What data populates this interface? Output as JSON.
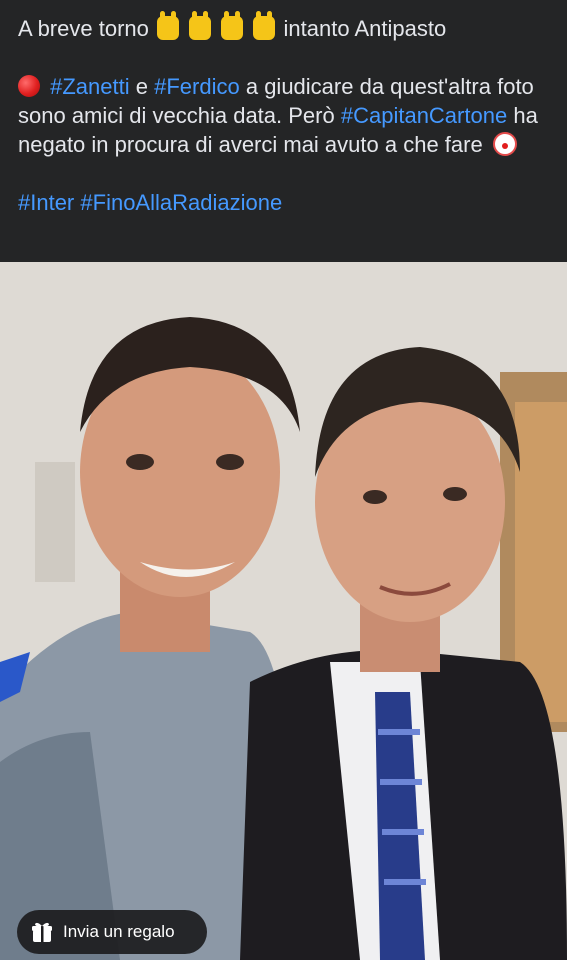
{
  "post": {
    "line1_pre": "A breve torno",
    "line1_post": "intanto Antipasto",
    "rock_icons": [
      "sign-of-horns-icon",
      "sign-of-horns-icon",
      "sign-of-horns-icon",
      "sign-of-horns-icon"
    ],
    "hashtag_zanetti": "#Zanetti",
    "conj": "e",
    "hashtag_ferdico": "#Ferdico",
    "text_a": "a giudicare da quest'altra foto sono amici di vecchia data. Però",
    "hashtag_capitan": "#CapitanCartone",
    "text_b": "ha negato in procura di averci mai avuto a che fare",
    "hashtag_inter": "#Inter",
    "hashtag_fino": "#FinoAllaRadiazione"
  },
  "colors": {
    "background": "#242526",
    "text": "#e4e6eb",
    "hashtag": "#4599ff"
  },
  "gift": {
    "label": "Invia un regalo"
  }
}
